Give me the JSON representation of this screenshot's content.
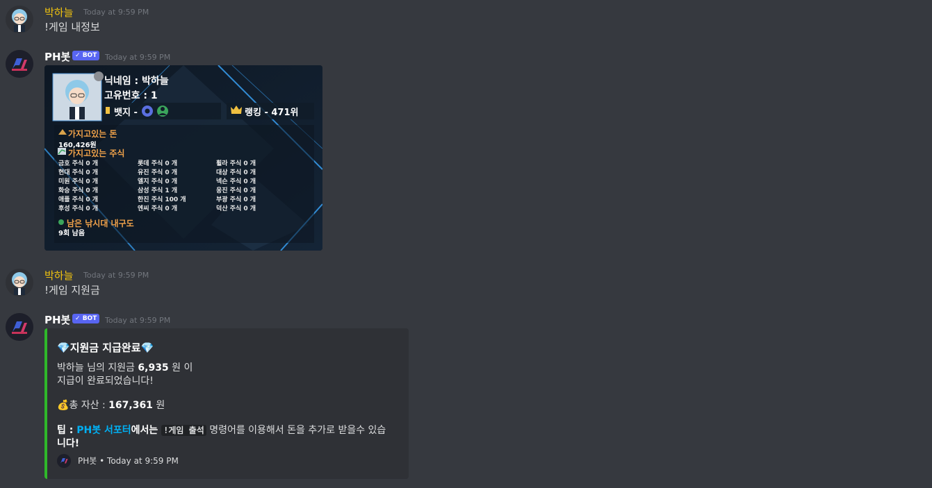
{
  "messages": [
    {
      "author": "박하늘",
      "time": "Today at 9:59 PM",
      "text": "!게임 내정보"
    },
    {
      "author": "PH봇",
      "bot_tag": "BOT",
      "time": "Today at 9:59 PM"
    },
    {
      "author": "박하늘",
      "time": "Today at 9:59 PM",
      "text": "!게임 지원금"
    },
    {
      "author": "PH봇",
      "bot_tag": "BOT",
      "time": "Today at 9:59 PM"
    }
  ],
  "profile_card": {
    "nickname": "닉네임 : 박하늘",
    "unique_id": "고유번호 : 1",
    "badge": "뱃지 -",
    "ranking": "랭킹 - 471위",
    "money_label": "가지고있는 돈",
    "money_value": "160,426원",
    "stocks_label": "가지고있는 주식",
    "stocks_col1": [
      "금호 주식 0 개",
      "현대 주식 0 개",
      "미원 주식 0 개",
      "화승 주식 0 개",
      "애플 주식 0 개",
      "후성 주식 0 개"
    ],
    "stocks_col2": [
      "롯데 주식 0 개",
      "유진 주식 0 개",
      "엘지 주식 0 개",
      "삼성 주식 1 개",
      "한진 주식 100 개",
      "엔씨 주식 0 개"
    ],
    "stocks_col3": [
      "휠라 주식 0 개",
      "대상 주식 0 개",
      "넥슨 주식 0 개",
      "웅진 주식 0 개",
      "부광 주식 0 개",
      "덕산 주식 0 개"
    ],
    "durability_label": "남은 낚시대 내구도",
    "durability_value": "9회 남음"
  },
  "embed": {
    "title": "지원금 지급완료",
    "line1_pre": "박하늘 님의 지원금 ",
    "line1_amount": "6,935",
    "line1_post": " 원 이",
    "line2": "지급이 완료되었습니다!",
    "total_pre": "총 자산 : ",
    "total_amount": "167,361",
    "total_post": " 원",
    "tip_pre": "팁 : ",
    "tip_link": "PH봇 서포터",
    "tip_mid": "에서는 ",
    "tip_code": "!게임 출석",
    "tip_post": " 명령어를 이용해서 돈을 추가로 받을수 있습",
    "tip_line2": "니다!",
    "footer_name": "PH봇",
    "footer_sep": "•",
    "footer_time": "Today at 9:59 PM",
    "accent_color": "#2fb82a"
  },
  "colors": {
    "user_name": "#f1c40f",
    "bot_tag": "#5865f2",
    "link": "#00b0f4"
  }
}
